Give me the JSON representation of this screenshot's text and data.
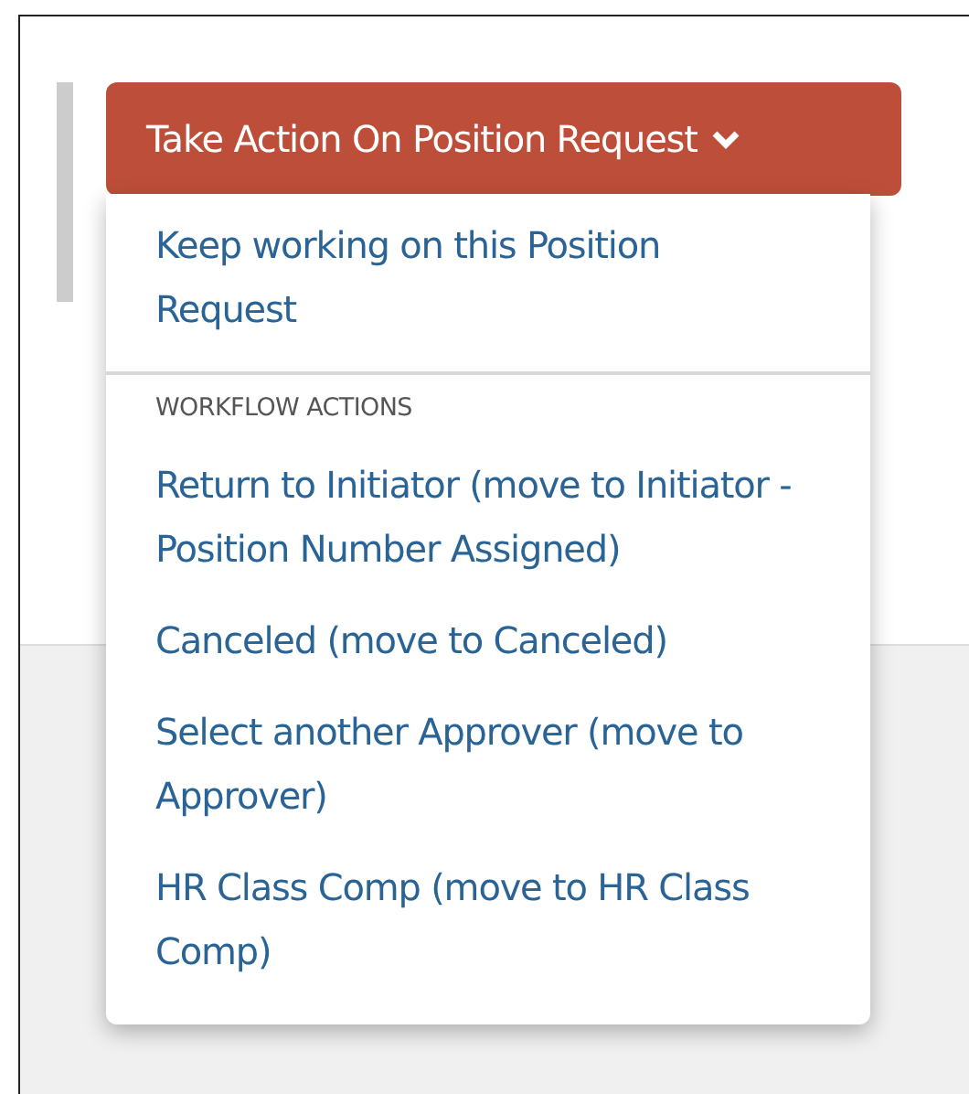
{
  "button": {
    "label": "Take Action On Position Request",
    "expanded": true
  },
  "menu": {
    "sections": [
      {
        "items": [
          "Keep working on this Position Request"
        ]
      },
      {
        "header": "WORKFLOW ACTIONS",
        "items": [
          "Return to Initiator (move to Initiator - Position Number Assigned)",
          "Canceled (move to Canceled)",
          "Select another Approver (move to Approver)",
          "HR Class Comp (move to HR Class Comp)"
        ]
      }
    ]
  }
}
